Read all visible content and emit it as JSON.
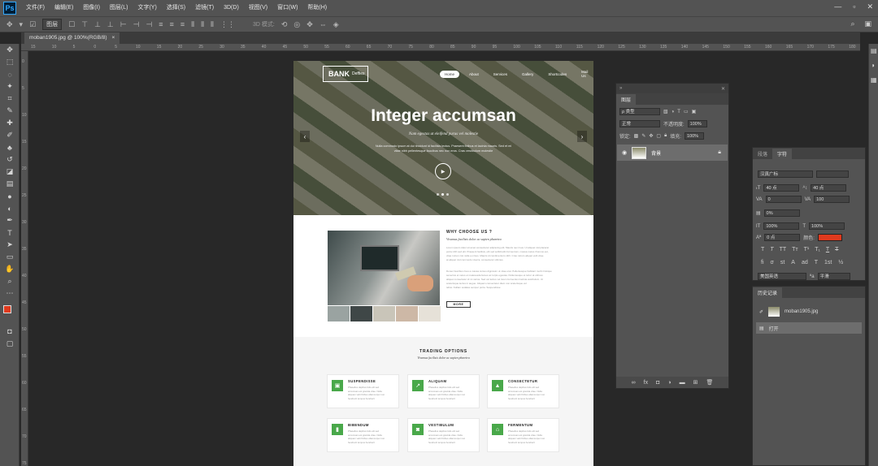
{
  "app": {
    "logo": "Ps"
  },
  "menu": [
    "文件(F)",
    "编辑(E)",
    "图像(I)",
    "图层(L)",
    "文字(Y)",
    "选择(S)",
    "滤镜(T)",
    "3D(D)",
    "视图(V)",
    "窗口(W)",
    "帮助(H)"
  ],
  "window_controls": [
    "—",
    "▫",
    "✕"
  ],
  "options_bar": {
    "auto_select": "图层",
    "mode_3d": "3D 模式:"
  },
  "document_tab": {
    "title": "moban1905.jpg @ 100%(RGB/8)",
    "close": "×"
  },
  "ruler": {
    "top_ticks": [
      "15",
      "10",
      "5",
      "0",
      "5",
      "10",
      "15",
      "20",
      "25",
      "30",
      "35",
      "40",
      "45",
      "50",
      "55",
      "60",
      "65",
      "70",
      "75",
      "80",
      "85",
      "90",
      "95",
      "100",
      "105",
      "110",
      "115",
      "120",
      "125",
      "130",
      "135",
      "140",
      "145",
      "150",
      "155",
      "160",
      "165",
      "170",
      "175",
      "180"
    ],
    "left_ticks": [
      "0",
      "5",
      "10",
      "15",
      "20",
      "25",
      "30",
      "35",
      "40",
      "45",
      "50",
      "55",
      "60",
      "65",
      "70",
      "75"
    ]
  },
  "site": {
    "logo": "BANK",
    "logo_sub": "Deffies",
    "nav": [
      "Home",
      "About",
      "Services",
      "Gallery",
      "Shortcodes",
      "Mail Us"
    ],
    "hero_title": "Integer accumsan",
    "hero_subtitle": "Nam egestas ut eleifend purus vel molestie",
    "hero_text": [
      "Nulla commodo ipsum at dui tincidunt id facilisis lectus. Praesent finibus et lacinia mauris. Sed et mi",
      "vitae nibh pellentesque faucibus nec non eros. Cras vestibulum molestie"
    ],
    "why_title": "WHY CHOOSE US ?",
    "why_subtitle": "Vivamus facilisis dolor ac sapien pharetra",
    "why_text": [
      "Lorem ipsum dolor sit amet consectetur adipiscing elit. Mauris nec risus. Ut aliquet nisl placerat",
      "porta nibh sed elit. Praesent facilisis, elit sed sollicitudin fermentum, massa metus rhoncus est,",
      "vitae rutrum nisi nulla eu risus. Mauris id condimentum nibh. Cras rutrum aliquet velit vitae",
      "at aliquet nisl commodo viverra, consectetur ultricies.",
      "",
      "Donec faucibus risus a massa cursus dignissim ut vitae erat. Pellentesque habitant morbi tristique",
      "senectus et netus et malesuada fames ac turpis egestas. Pellentesque et tortor at ultrices",
      "aliquet consectetur id mi varius. Sed vel lectus vel lorem fermentum lacinia vestibulum. Ut",
      "scelerisque lectus in augue. Aliquam consectetur diam non scelerisque vel",
      "tellus. Nullam sodales semper porta. Suspendisse"
    ],
    "why_button": "MORE",
    "trading_title": "TRADING OPTIONS",
    "trading_subtitle": "Vivamus facilisis dolor ac sapien pharetra",
    "cards": [
      {
        "title": "SUSPENDISSE",
        "icon": "▣",
        "text": [
          "Phasellus dapibus felis elit sed",
          "accumsan est gravida vitae. Nulla",
          "aliquam velit finibus ullamcorper non",
          "hendrerit tempus hendrerit"
        ]
      },
      {
        "title": "ALIQUAM",
        "icon": "↗",
        "text": [
          "Phasellus dapibus felis elit sed",
          "accumsan est gravida vitae. Nulla",
          "aliquam velit finibus ullamcorper non",
          "hendrerit tempus hendrerit"
        ]
      },
      {
        "title": "CONSECTETUR",
        "icon": "▲",
        "text": [
          "Phasellus dapibus felis elit sed",
          "accumsan est gravida vitae. Nulla",
          "aliquam velit finibus ullamcorper non",
          "hendrerit tempus hendrerit"
        ]
      },
      {
        "title": "BIBENDUM",
        "icon": "▮",
        "text": [
          "Phasellus dapibus felis elit sed",
          "accumsan est gravida vitae. Nulla",
          "aliquam velit finibus ullamcorper non",
          "hendrerit tempus hendrerit"
        ]
      },
      {
        "title": "VESTIBULUM",
        "icon": "◙",
        "text": [
          "Phasellus dapibus felis elit sed",
          "accumsan est gravida vitae. Nulla",
          "aliquam velit finibus ullamcorper non",
          "hendrerit tempus hendrerit"
        ]
      },
      {
        "title": "FERMENTUM",
        "icon": "⌂",
        "text": [
          "Phasellus dapibus felis elit sed",
          "accumsan est gravida vitae. Nulla",
          "aliquam velit finibus ullamcorper non",
          "hendrerit tempus hendrerit"
        ]
      }
    ]
  },
  "layers_panel": {
    "tab": "图层",
    "kind_filter": "ρ 类型",
    "blend_mode": "正常",
    "opacity_label": "不透明度:",
    "opacity_value": "100%",
    "lock_label": "锁定:",
    "fill_label": "填充:",
    "fill_value": "100%",
    "layer_name": "背景"
  },
  "char_panel": {
    "tabs": [
      "段落",
      "字符"
    ],
    "font_family": "汉真广标",
    "font_size": "40 点",
    "leading": "40 点",
    "kerning": "0",
    "tracking": "100",
    "vert_scale_pct": "0%",
    "scale_v": "100%",
    "scale_h": "100%",
    "baseline": "0 点",
    "color_label": "颜色:",
    "color_value": "#e03a1e",
    "language": "美国英语",
    "aa": "平滑"
  },
  "history_panel": {
    "tabs": [
      "历史记录"
    ],
    "items": [
      "moban1905.jpg",
      "打开"
    ]
  }
}
